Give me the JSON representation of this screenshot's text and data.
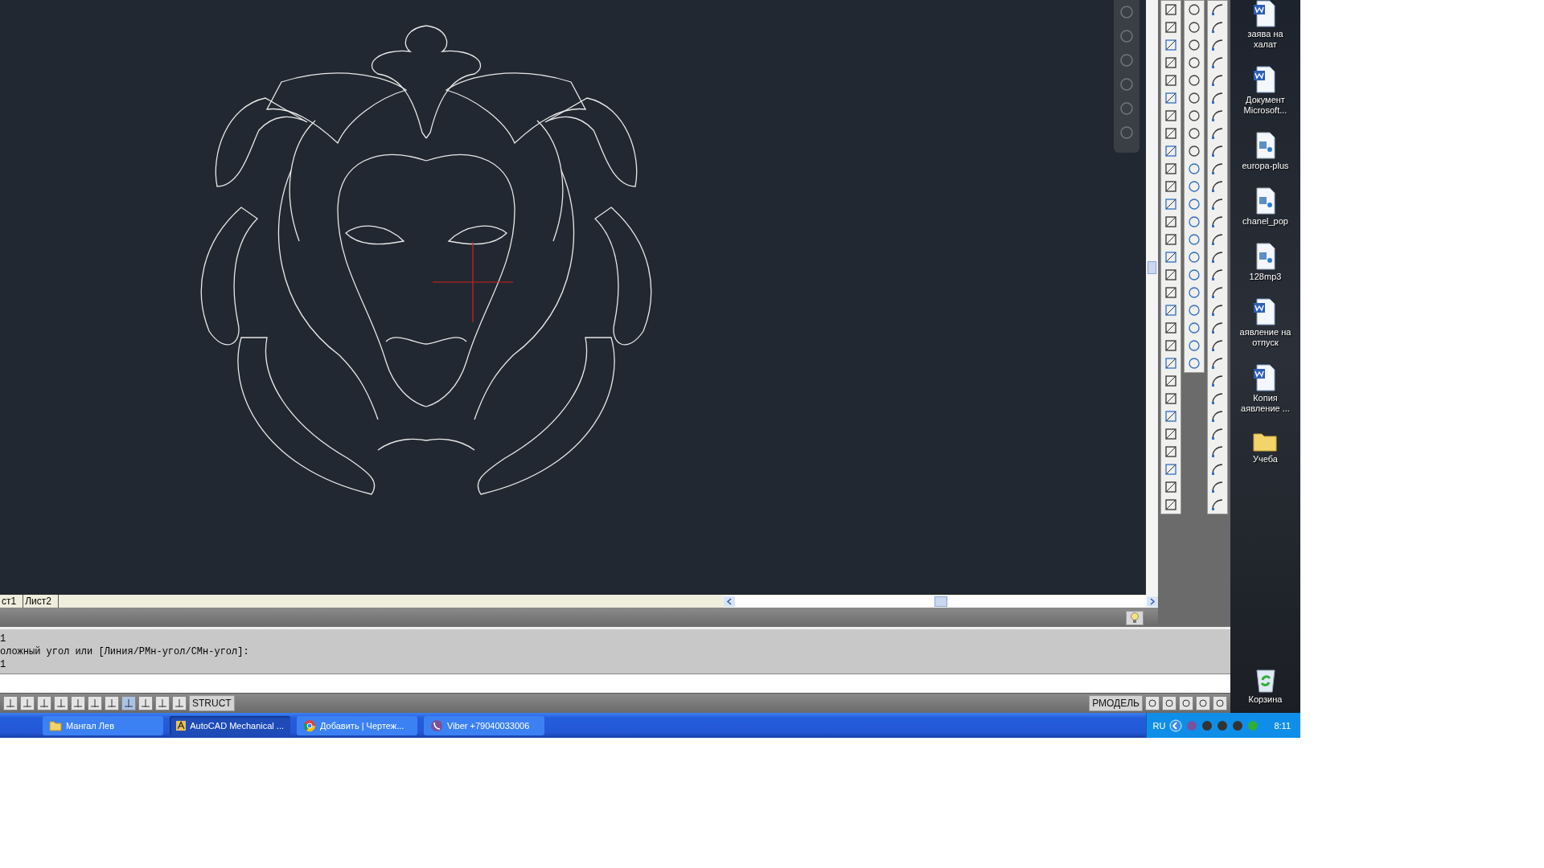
{
  "layout_tabs": [
    {
      "label": "ст1",
      "selected": false
    },
    {
      "label": "Лист2",
      "selected": false
    }
  ],
  "command_lines": [
    "1",
    "оложный угол или [Линия/РМн-угол/СМн-угол]:",
    "1"
  ],
  "status_bar": {
    "toggle_label": "STRUCT",
    "space_label": "РМОДЕЛЬ"
  },
  "desktop_icons": [
    {
      "kind": "word",
      "lines": [
        "заява на",
        "халат"
      ]
    },
    {
      "kind": "word",
      "lines": [
        "Документ",
        "Microsoft..."
      ]
    },
    {
      "kind": "media",
      "lines": [
        "europa-plus"
      ]
    },
    {
      "kind": "media",
      "lines": [
        "chanel_pop"
      ]
    },
    {
      "kind": "media",
      "lines": [
        "128mp3"
      ]
    },
    {
      "kind": "word",
      "lines": [
        "аявление на",
        "отпуск"
      ]
    },
    {
      "kind": "word",
      "lines": [
        "Копия",
        "аявление ..."
      ]
    },
    {
      "kind": "folder",
      "lines": [
        "Учеба"
      ]
    }
  ],
  "recycle_bin": {
    "label": "Корзина"
  },
  "taskbar": {
    "buttons": [
      {
        "kind": "folder",
        "label": "Мангал Лев",
        "selected": false
      },
      {
        "kind": "cad",
        "label": "AutoCAD Mechanical ...",
        "selected": true
      },
      {
        "kind": "browser",
        "label": "Добавить | Чертеж...",
        "selected": false
      },
      {
        "kind": "phone",
        "label": "Viber +79040033006",
        "selected": false
      }
    ],
    "language": "RU",
    "clock": "8:11"
  }
}
